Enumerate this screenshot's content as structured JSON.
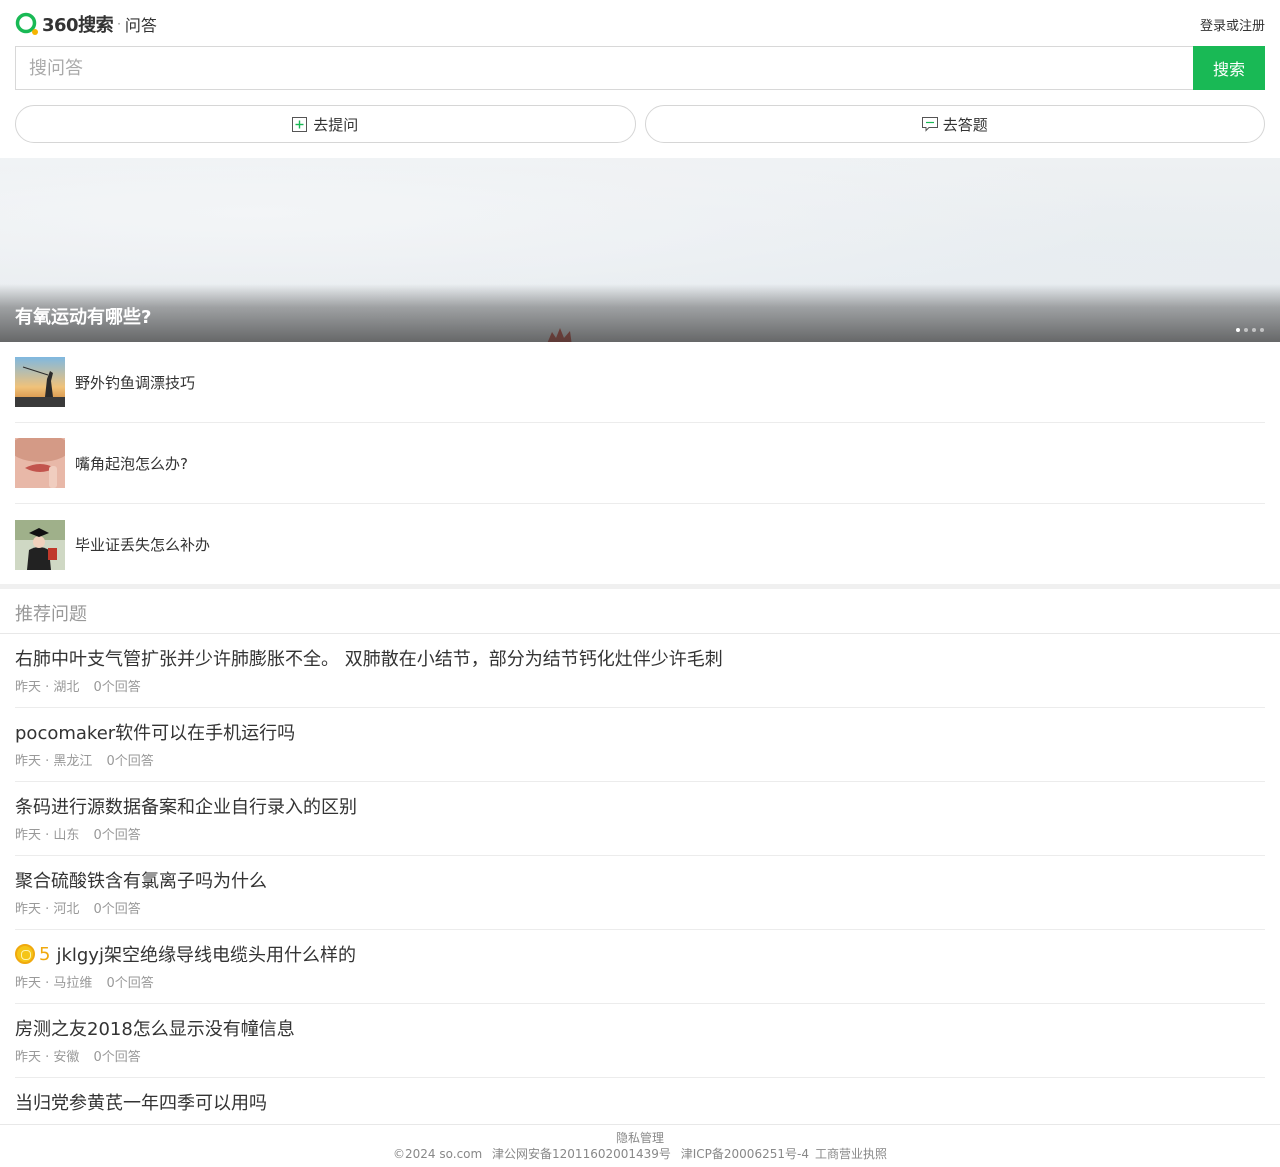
{
  "header": {
    "logo_text": "360搜索",
    "logo_sep": "·",
    "logo_sub": "问答",
    "login_label": "登录或注册"
  },
  "search": {
    "placeholder": "搜问答",
    "button_label": "搜索"
  },
  "actions": {
    "ask_label": "去提问",
    "answer_label": "去答题",
    "ask_icon": "plus-square-icon",
    "answer_icon": "chat-bubble-icon"
  },
  "banner": {
    "title": "有氧运动有哪些?",
    "slide_count": 4,
    "active_slide": 1
  },
  "topics": [
    {
      "label": "野外钓鱼调漂技巧"
    },
    {
      "label": "嘴角起泡怎么办?"
    },
    {
      "label": "毕业证丢失怎么补办"
    }
  ],
  "recommended": {
    "title": "推荐问题",
    "questions": [
      {
        "title": "右肺中叶支气管扩张并少许肺膨胀不全。 双肺散在小结节，部分为结节钙化灶伴少许毛刺",
        "time": "昨天",
        "region": "湖北",
        "answers": "0个回答"
      },
      {
        "title": "pocomaker软件可以在手机运行吗",
        "time": "昨天",
        "region": "黑龙江",
        "answers": "0个回答"
      },
      {
        "title": "条码进行源数据备案和企业自行录入的区别",
        "time": "昨天",
        "region": "山东",
        "answers": "0个回答"
      },
      {
        "title": "聚合硫酸铁含有氯离子吗为什么",
        "time": "昨天",
        "region": "河北",
        "answers": "0个回答"
      },
      {
        "title": "jklgyj架空绝缘导线电缆头用什么样的",
        "reward": "5",
        "time": "昨天",
        "region": "马拉维",
        "answers": "0个回答"
      },
      {
        "title": "房测之友2018怎么显示没有幢信息",
        "time": "昨天",
        "region": "安徽",
        "answers": "0个回答"
      },
      {
        "title": "当归党参黄芪一年四季可以用吗"
      }
    ]
  },
  "footer": {
    "privacy": "隐私管理",
    "copyright": "©2024 so.com",
    "police": "津公网安备12011602001439号",
    "icp": "津ICP备20006251号-4",
    "license": "工商营业执照"
  },
  "colors": {
    "brand_green": "#19b955",
    "reward_gold": "#f0a90e"
  }
}
